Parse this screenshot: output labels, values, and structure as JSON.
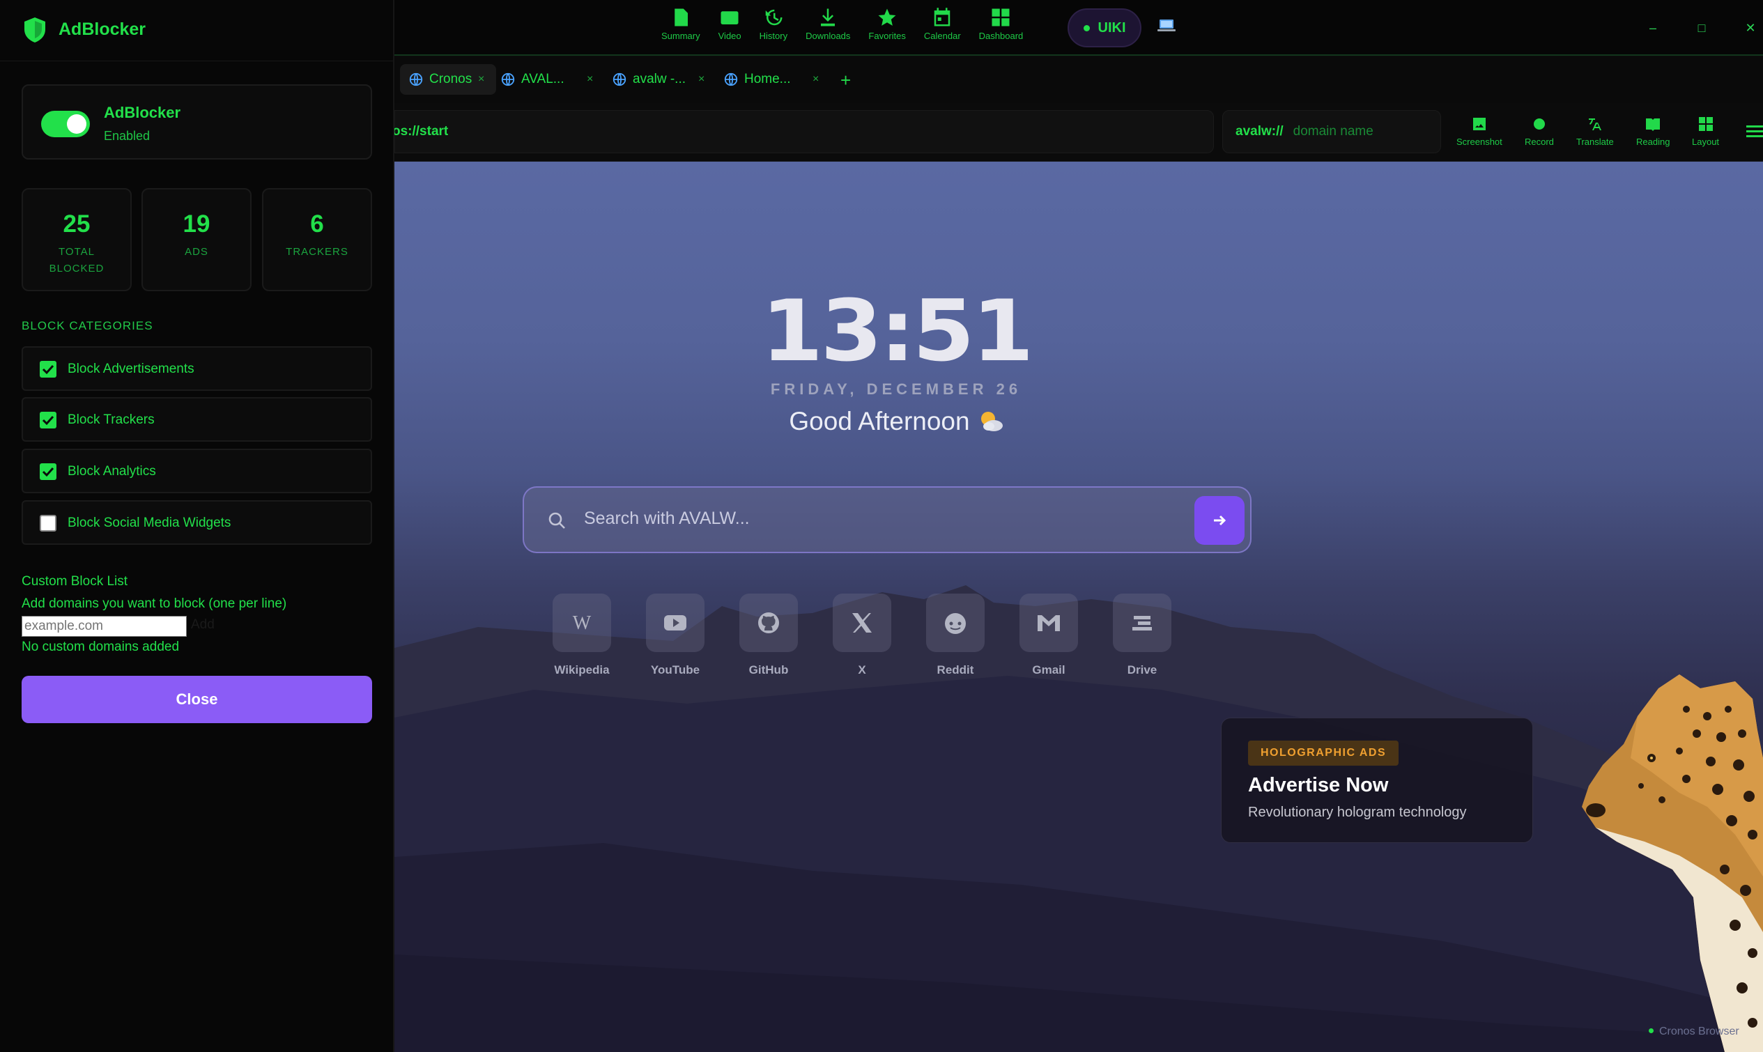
{
  "adblocker": {
    "title": "AdBlocker",
    "toggle_name": "AdBlocker",
    "toggle_state": "Enabled",
    "stats": [
      {
        "value": "25",
        "label_line1": "TOTAL",
        "label_line2": "BLOCKED"
      },
      {
        "value": "19",
        "label_line1": "ADS",
        "label_line2": ""
      },
      {
        "value": "6",
        "label_line1": "TRACKERS",
        "label_line2": ""
      }
    ],
    "categories_heading": "BLOCK CATEGORIES",
    "categories": [
      {
        "label": "Block Advertisements",
        "checked": true
      },
      {
        "label": "Block Trackers",
        "checked": true
      },
      {
        "label": "Block Analytics",
        "checked": true
      },
      {
        "label": "Block Social Media Widgets",
        "checked": false
      }
    ],
    "custom_title": "Custom Block List",
    "custom_hint": "Add domains you want to block (one per line)",
    "custom_placeholder": "example.com",
    "custom_add": "Add",
    "custom_empty": "No custom domains added",
    "close_label": "Close"
  },
  "toolbar": {
    "items": [
      {
        "label": "Summary",
        "icon": "summary-icon"
      },
      {
        "label": "Video",
        "icon": "video-icon"
      },
      {
        "label": "History",
        "icon": "history-icon"
      },
      {
        "label": "Downloads",
        "icon": "downloads-icon"
      },
      {
        "label": "Favorites",
        "icon": "star-icon"
      },
      {
        "label": "Calendar",
        "icon": "calendar-icon"
      },
      {
        "label": "Dashboard",
        "icon": "dashboard-icon"
      }
    ],
    "pill_label": "UIKI"
  },
  "window_controls": {
    "minimize": "–",
    "maximize": "□",
    "close": "✕"
  },
  "tabs": [
    {
      "title": "Cronos",
      "active": true
    },
    {
      "title": "AVAL...",
      "active": false
    },
    {
      "title": "avalw -...",
      "active": false
    },
    {
      "title": "Home...",
      "active": false
    }
  ],
  "tab_close": "×",
  "tab_add": "+",
  "address": {
    "url": "os://start",
    "domain_protocol": "avalw://",
    "domain_placeholder": "domain name"
  },
  "tools": [
    {
      "label": "Screenshot",
      "icon": "image-icon"
    },
    {
      "label": "Record",
      "icon": "record-icon"
    },
    {
      "label": "Translate",
      "icon": "translate-icon"
    },
    {
      "label": "Reading",
      "icon": "book-icon"
    },
    {
      "label": "Layout",
      "icon": "layout-icon"
    }
  ],
  "newtab": {
    "clock": "13:51",
    "date": "FRIDAY, DECEMBER 26",
    "greeting": "Good Afternoon",
    "search_placeholder": "Search with AVALW...",
    "shortcuts": [
      {
        "label": "Wikipedia",
        "icon": "wikipedia-icon"
      },
      {
        "label": "YouTube",
        "icon": "youtube-icon"
      },
      {
        "label": "GitHub",
        "icon": "github-icon"
      },
      {
        "label": "X",
        "icon": "x-icon"
      },
      {
        "label": "Reddit",
        "icon": "reddit-icon"
      },
      {
        "label": "Gmail",
        "icon": "gmail-icon"
      },
      {
        "label": "Drive",
        "icon": "drive-icon"
      }
    ],
    "ad": {
      "tag": "HOLOGRAPHIC ADS",
      "title": "Advertise Now",
      "subtitle": "Revolutionary hologram technology"
    },
    "footer_brand": "Cronos Browser"
  },
  "colors": {
    "accent_green": "#22e04a",
    "accent_purple": "#8b5cf6",
    "ad_orange": "#f0a030"
  }
}
